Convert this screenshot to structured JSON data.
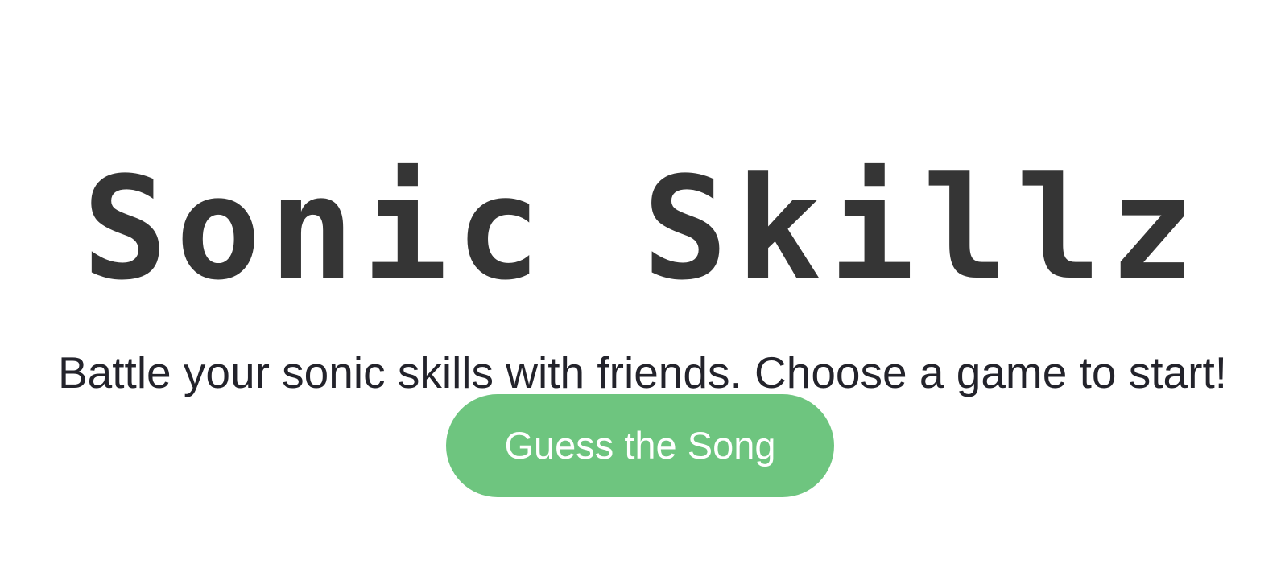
{
  "header": {
    "title": "Sonic Skillz"
  },
  "main": {
    "tagline": "Battle your sonic skills with friends. Choose a game to start!",
    "game_button_label": "Guess the Song"
  },
  "colors": {
    "title": "#353535",
    "text": "#23232b",
    "button": "#6ec57f",
    "button_text": "#ffffff",
    "background": "#ffffff"
  }
}
